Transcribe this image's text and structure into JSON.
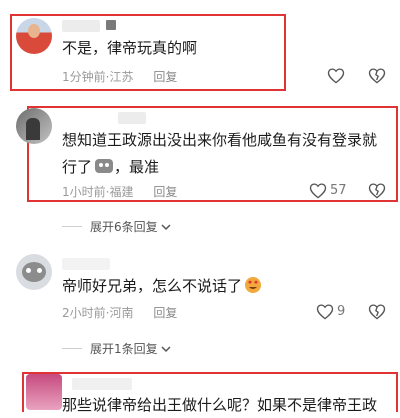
{
  "comments": [
    {
      "text": "不是，律帝玩真的啊",
      "time": "1分钟前",
      "location": "江苏",
      "reply": "回复",
      "likes": ""
    },
    {
      "text_line1": "想知道王政源出没出来你看他咸鱼有没有登录就",
      "text_line2": "行了",
      "text_line2_tail": "，最准",
      "time": "1小时前",
      "location": "福建",
      "reply": "回复",
      "likes": "57"
    },
    {
      "text": "帝师好兄弟，怎么不说话了",
      "time": "2小时前",
      "location": "河南",
      "reply": "回复",
      "likes": "9"
    }
  ],
  "expand1": "展开6条回复",
  "expand2": "展开1条回复",
  "partial_text": "那些说律帝给出王做什么呢？如果不是律帝王政",
  "separator": "·",
  "colors": {
    "highlight": "#e03434",
    "meta": "#9a9a9a"
  }
}
